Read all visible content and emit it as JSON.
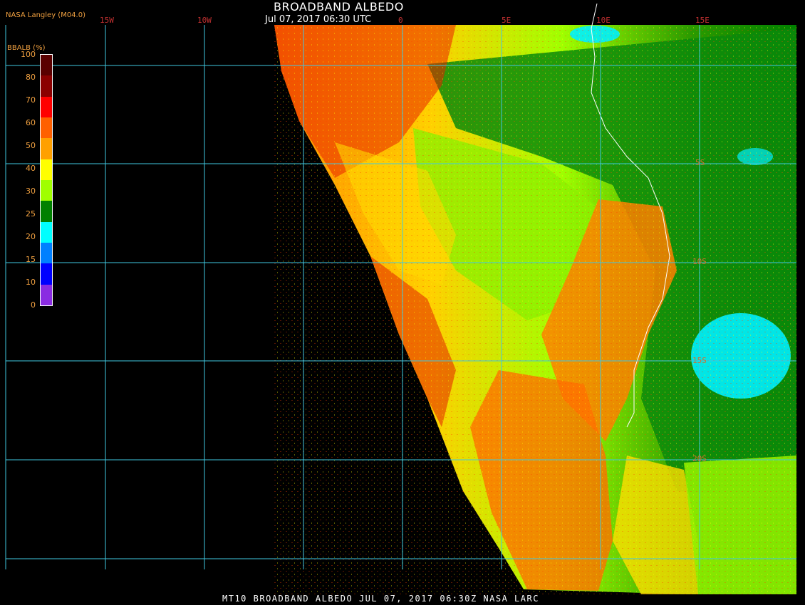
{
  "header": {
    "title": "BROADBAND ALBEDO",
    "datetime": "Jul 07, 2017 06:30 UTC",
    "credit": "NASA Langley (M04.0)"
  },
  "footer": "MT10  BROADBAND ALBEDO   JUL 07, 2017 06:30Z   NASA LARC",
  "colorbar": {
    "title": "BBALB (%)",
    "labels": [
      "100",
      "80",
      "70",
      "60",
      "50",
      "40",
      "30",
      "25",
      "20",
      "15",
      "10",
      "0"
    ],
    "colors": [
      "#5a0000",
      "#8b0000",
      "#ff0000",
      "#ff6000",
      "#ffa000",
      "#ffff00",
      "#a0ff00",
      "#008000",
      "#00ffff",
      "#0080ff",
      "#0000ff",
      "#8a2be2"
    ]
  },
  "longitude_labels": [
    "15W",
    "10W",
    "0",
    "5E",
    "10E",
    "15E"
  ],
  "latitude_labels": [
    "5S",
    "10S",
    "15S",
    "20S"
  ],
  "colors": {
    "gridline": "#40c8e0",
    "background": "#000000",
    "label": "#f0a040",
    "coast": "#ffffff"
  }
}
